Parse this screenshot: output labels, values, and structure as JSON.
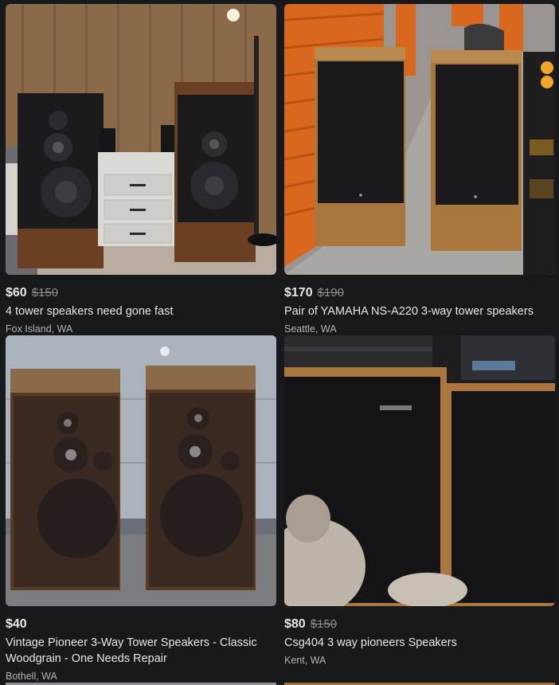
{
  "listings": [
    {
      "price": "$60",
      "old_price": "$150",
      "title": "4 tower speakers need gone fast",
      "location": "Fox Island, WA",
      "image_subject": "speakers-wood-paneled-room"
    },
    {
      "price": "$170",
      "old_price": "$190",
      "title": "Pair of YAMAHA NS-A220 3-way tower speakers",
      "location": "Seattle, WA",
      "image_subject": "speakers-storage-unit"
    },
    {
      "price": "$40",
      "old_price": "",
      "title": "Vintage Pioneer 3-Way Tower Speakers - Classic Woodgrain - One Needs Repair",
      "location": "Bothell, WA",
      "image_subject": "speakers-against-garage-wall"
    },
    {
      "price": "$80",
      "old_price": "$150",
      "title": "Csg404 3 way pioneers Speakers",
      "location": "Kent, WA",
      "image_subject": "speakers-with-stereo-and-cat"
    }
  ],
  "colors": {
    "background": "#18191a",
    "text_primary": "#e4e6eb",
    "text_secondary": "#b0b3b8",
    "strikethrough": "#8a8d91"
  }
}
